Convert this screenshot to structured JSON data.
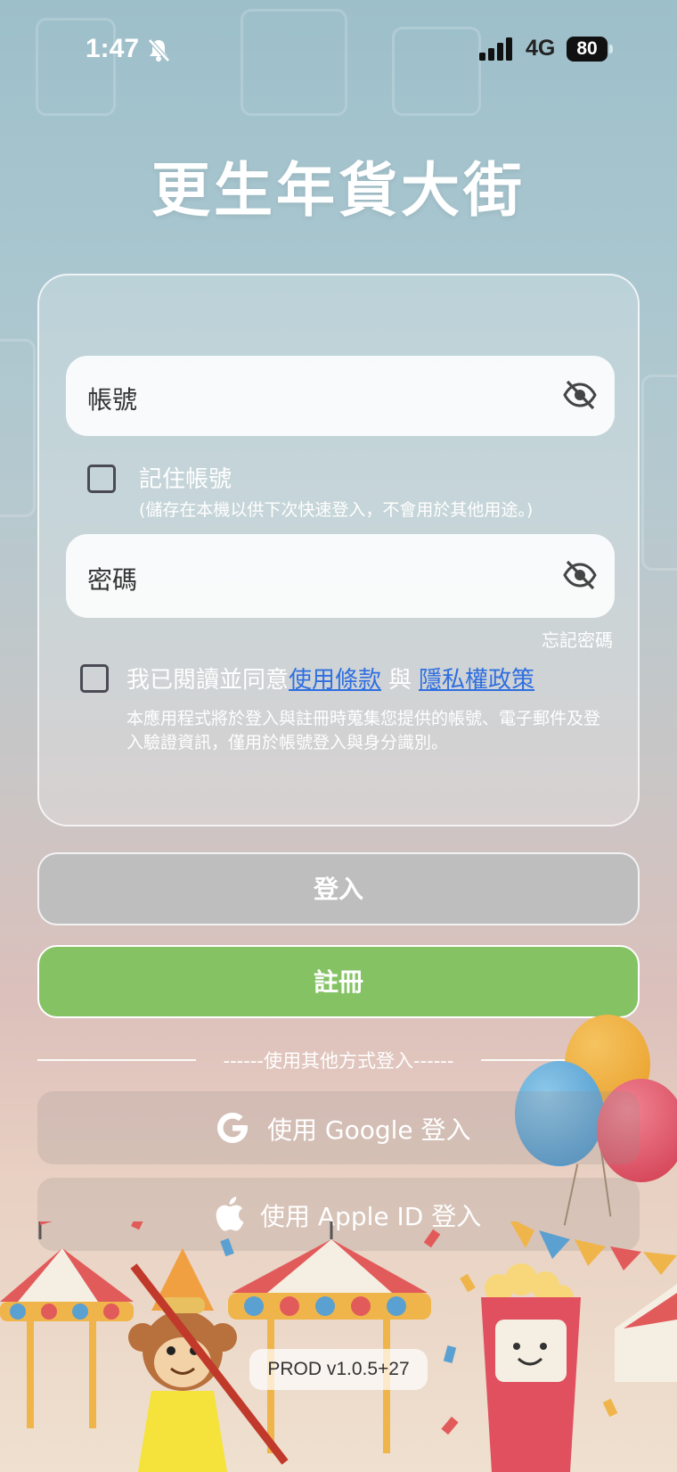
{
  "status_bar": {
    "time": "1:47",
    "network": "4G",
    "battery": "80"
  },
  "app": {
    "title": "更生年貨大街"
  },
  "login_form": {
    "username_label": "帳號",
    "remember_label": "記住帳號",
    "remember_note": "(儲存在本機以供下次快速登入，不會用於其他用途。)",
    "password_label": "密碼",
    "forgot_password": "忘記密碼",
    "agree_prefix": "我已閱讀並同意",
    "terms_link": "使用條款",
    "agree_and": "與",
    "privacy_link": "隱私權政策",
    "consent_note": "本應用程式將於登入與註冊時蒐集您提供的帳號、電子郵件及登入驗證資訊，僅用於帳號登入與身分識別。",
    "remember_checked": false,
    "agree_checked": false
  },
  "actions": {
    "login_label": "登入",
    "register_label": "註冊",
    "divider_text": "------使用其他方式登入------",
    "google_label": "使用 Google 登入",
    "apple_label": "使用 Apple ID 登入"
  },
  "footer": {
    "version": "PROD v1.0.5+27"
  },
  "colors": {
    "register_green": "#84c264",
    "link_blue": "#2f6fe0",
    "login_disabled": "#bebebe"
  },
  "icons": {
    "bell": "bell-slash-icon",
    "signal": "cellular-signal-icon",
    "eye": "eye-slash-icon",
    "google": "google-icon",
    "apple": "apple-icon"
  }
}
